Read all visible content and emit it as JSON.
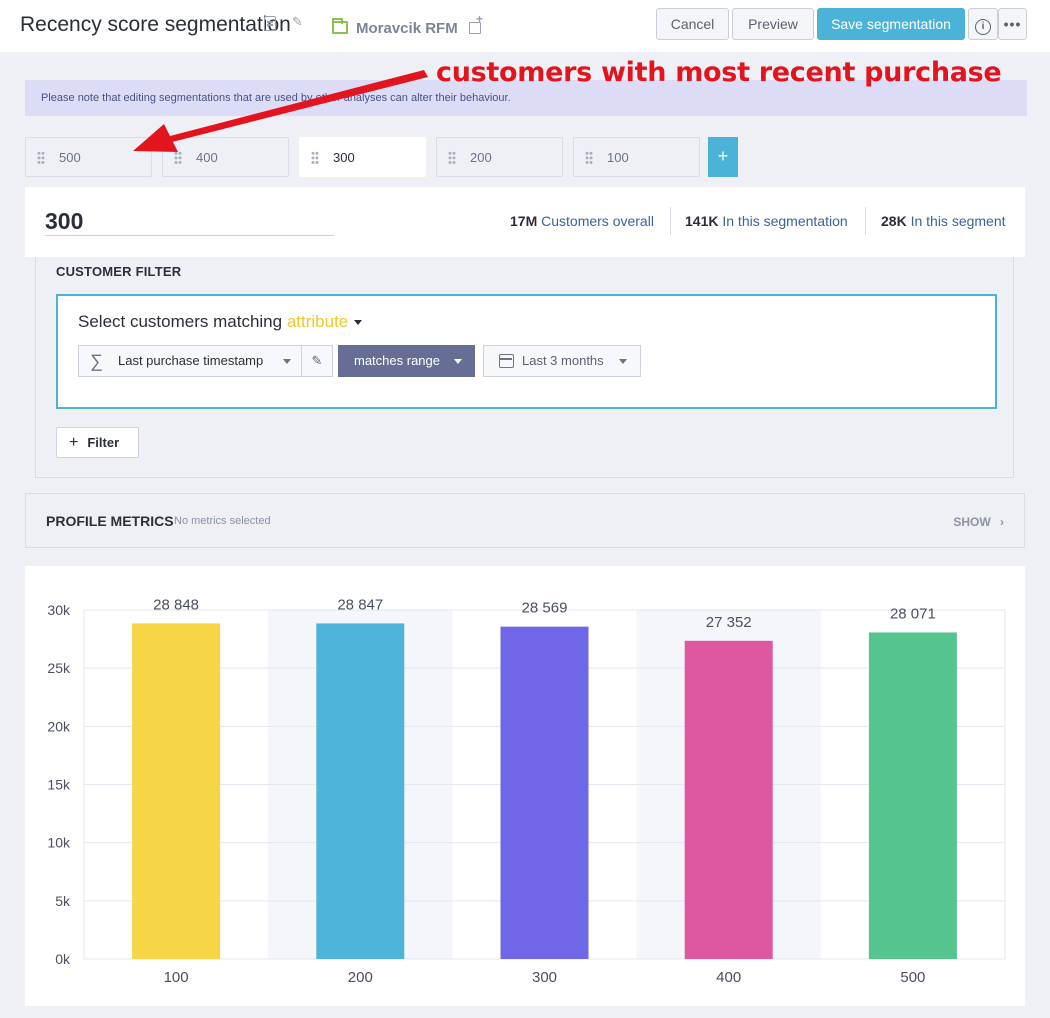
{
  "header": {
    "title": "Recency score segmentation",
    "folder": "Moravcik RFM",
    "cancel_label": "Cancel",
    "preview_label": "Preview",
    "save_label": "Save segmentation",
    "info_label": "i",
    "more_label": "•••"
  },
  "notice": "Please note that editing segmentations that are used by other analyses can alter their behaviour.",
  "segments": [
    {
      "label": "500",
      "active": false
    },
    {
      "label": "400",
      "active": false
    },
    {
      "label": "300",
      "active": true
    },
    {
      "label": "200",
      "active": false
    },
    {
      "label": "100",
      "active": false
    }
  ],
  "add_segment_label": "+",
  "selected_segment": {
    "name": "300",
    "stats": [
      {
        "value": "17M",
        "label": "Customers overall"
      },
      {
        "value": "141K",
        "label": "In this segmentation"
      },
      {
        "value": "28K",
        "label": "In this segment"
      }
    ]
  },
  "customer_filter": {
    "heading": "CUSTOMER FILTER",
    "match_prefix": "Select customers matching",
    "match_type": "attribute",
    "attribute": "Last purchase timestamp",
    "operator": "matches range",
    "range": "Last 3 months",
    "add_filter_label": "Filter"
  },
  "profile_metrics": {
    "title": "PROFILE METRICS",
    "subtitle": "No metrics selected",
    "show_label": "SHOW"
  },
  "chart_data": {
    "type": "bar",
    "categories": [
      "100",
      "200",
      "300",
      "400",
      "500"
    ],
    "values": [
      28848,
      28847,
      28569,
      27352,
      28071
    ],
    "value_labels": [
      "28 848",
      "28 847",
      "28 569",
      "27 352",
      "28 071"
    ],
    "colors": [
      "#f6d647",
      "#4eb4d9",
      "#7067e8",
      "#dd58a0",
      "#56c48f"
    ],
    "ylim": [
      0,
      30000
    ],
    "yticks": [
      "0k",
      "5k",
      "10k",
      "15k",
      "20k",
      "25k",
      "30k"
    ],
    "grid": true
  },
  "annotation": {
    "text": "customers with most recent purchase",
    "color": "#e3141e"
  }
}
